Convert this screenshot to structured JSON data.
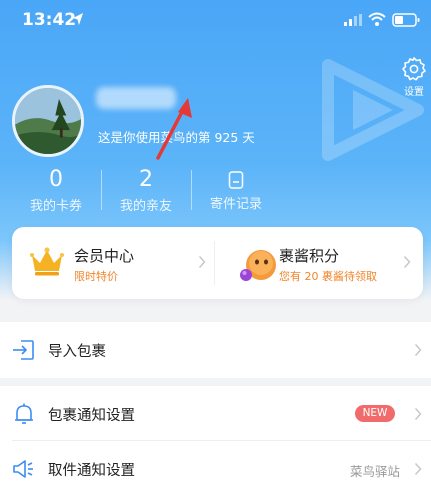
{
  "status_bar": {
    "time": "13:42"
  },
  "settings": {
    "label": "设置"
  },
  "profile": {
    "days_text": "这是你使用菜鸟的第 925 天"
  },
  "stats": [
    {
      "value": "0",
      "label": "我的卡券"
    },
    {
      "value": "2",
      "label": "我的亲友"
    },
    {
      "label": "寄件记录"
    }
  ],
  "membership_card": {
    "vip": {
      "title": "会员中心",
      "subtitle": "限时特价"
    },
    "points": {
      "title": "裹酱积分",
      "subtitle": "您有 20 裹酱待领取"
    }
  },
  "list": {
    "import": {
      "label": "导入包裹"
    },
    "notify": {
      "label": "包裹通知设置",
      "badge": "NEW"
    },
    "pickup": {
      "label": "取件通知设置",
      "value": "菜鸟驿站"
    }
  },
  "colors": {
    "accent": "#4aa6f7",
    "orange": "#f0862c",
    "badge_red": "#f06c6c",
    "arrow_red": "#e53935"
  }
}
